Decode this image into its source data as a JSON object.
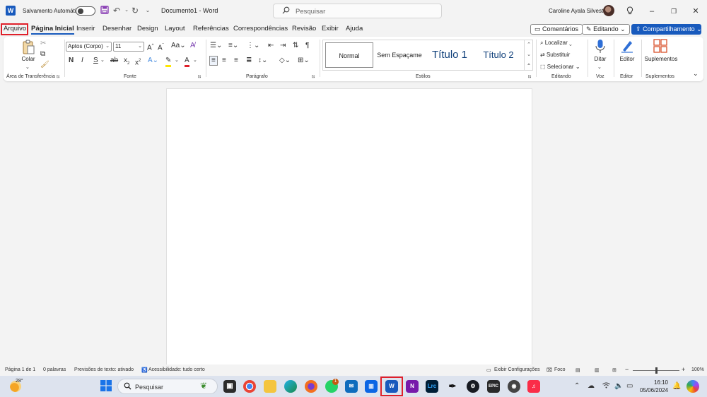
{
  "titlebar": {
    "autosave_label": "Salvamento Automático",
    "doc_title": "Documento1  -  Word",
    "search_placeholder": "Pesquisar",
    "user_name": "Caroline Ayala Silvestre"
  },
  "tabs": [
    "Arquivo",
    "Página Inicial",
    "Inserir",
    "Desenhar",
    "Design",
    "Layout",
    "Referências",
    "Correspondências",
    "Revisão",
    "Exibir",
    "Ajuda"
  ],
  "active_tab": "Página Inicial",
  "ribbon_buttons": {
    "comments": "Comentários",
    "editing": "Editando",
    "share": "Compartilhamento"
  },
  "ribbon": {
    "clipboard": {
      "paste_label": "Colar",
      "group_label": "Área de Transferência"
    },
    "font": {
      "font_name": "Aptos (Corpo)",
      "font_size": "11",
      "group_label": "Fonte",
      "bold": "N",
      "italic": "I",
      "underline": "S"
    },
    "paragraph": {
      "group_label": "Parágrafo"
    },
    "styles": {
      "items": [
        "Normal",
        "Sem Espaçame",
        "Título 1",
        "Título 2"
      ],
      "group_label": "Estilos"
    },
    "editing": {
      "find": "Localizar",
      "replace": "Substituir",
      "select": "Selecionar",
      "group_label": "Editando"
    },
    "voice": {
      "dictate": "Ditar",
      "group_label": "Voz"
    },
    "editor": {
      "label": "Editor",
      "group_label": "Editor"
    },
    "addins": {
      "label": "Suplementos",
      "group_label": "Suplementos"
    }
  },
  "statusbar": {
    "page": "Página 1 de 1",
    "words": "0 palavras",
    "predictions": "Previsões de texto: ativado",
    "accessibility": "Acessibilidade: tudo certo",
    "display_settings": "Exibir Configurações",
    "focus": "Foco",
    "zoom": "100%",
    "zoom_minus": "−",
    "zoom_plus": "+"
  },
  "taskbar": {
    "temperature": "28°",
    "search_placeholder": "Pesquisar",
    "time": "16:10",
    "date": "05/06/2024",
    "whatsapp_badge": "1"
  },
  "colors": {
    "accent": "#185abd",
    "highlight": "#e0202a",
    "page": "#ffffff",
    "background": "#f3f3f3"
  }
}
